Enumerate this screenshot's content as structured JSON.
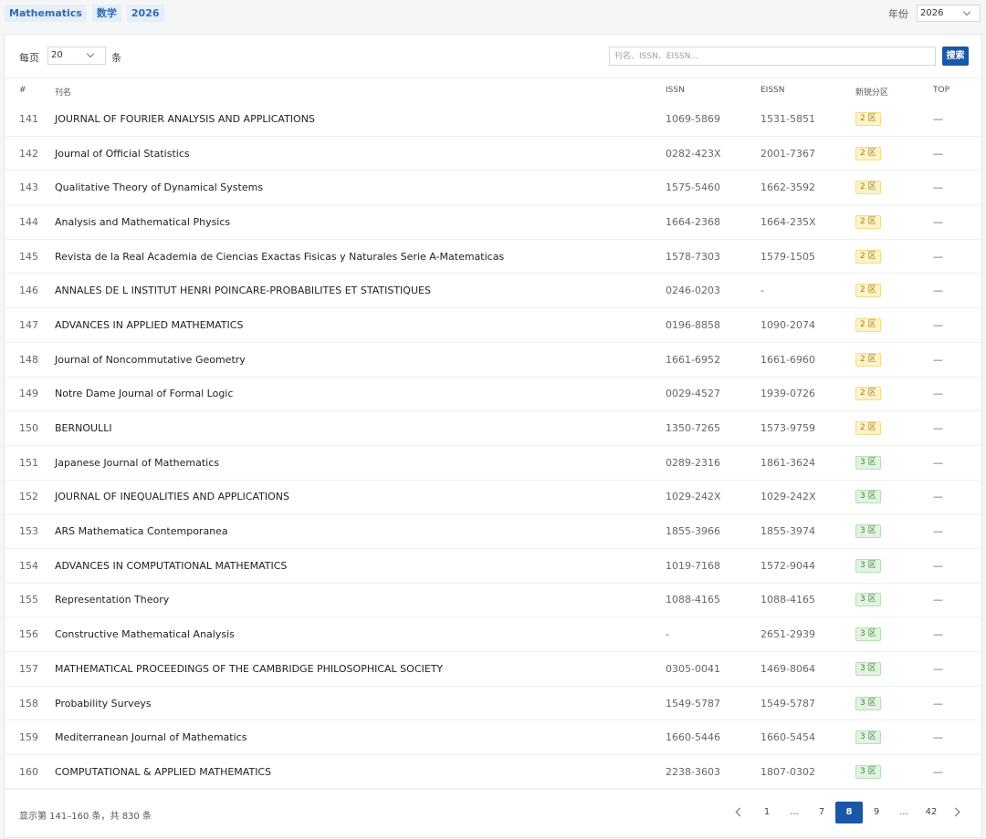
{
  "tags": [
    "Mathematics",
    "数学",
    "2026"
  ],
  "year_filter": {
    "label": "年份",
    "value": "2026"
  },
  "controls": {
    "per_page_label": "每页",
    "per_page_value": "20",
    "per_page_unit": "条",
    "search_placeholder": "刊名、ISSN、EISSN...",
    "search_button": "搜索"
  },
  "table": {
    "headers": [
      "#",
      "刊名",
      "ISSN",
      "EISSN",
      "新锐分区",
      "TOP"
    ],
    "rows": [
      {
        "num": "141",
        "name": "JOURNAL OF FOURIER ANALYSIS AND APPLICATIONS",
        "issn": "1069-5869",
        "eissn": "1531-5851",
        "zone": "2 区",
        "top": "—"
      },
      {
        "num": "142",
        "name": "Journal of Official Statistics",
        "issn": "0282-423X",
        "eissn": "2001-7367",
        "zone": "2 区",
        "top": "—"
      },
      {
        "num": "143",
        "name": "Qualitative Theory of Dynamical Systems",
        "issn": "1575-5460",
        "eissn": "1662-3592",
        "zone": "2 区",
        "top": "—"
      },
      {
        "num": "144",
        "name": "Analysis and Mathematical Physics",
        "issn": "1664-2368",
        "eissn": "1664-235X",
        "zone": "2 区",
        "top": "—"
      },
      {
        "num": "145",
        "name": "Revista de la Real Academia de Ciencias Exactas Fisicas y Naturales Serie A-Matematicas",
        "issn": "1578-7303",
        "eissn": "1579-1505",
        "zone": "2 区",
        "top": "—"
      },
      {
        "num": "146",
        "name": "ANNALES DE L INSTITUT HENRI POINCARE-PROBABILITES ET STATISTIQUES",
        "issn": "0246-0203",
        "eissn": "-",
        "zone": "2 区",
        "top": "—"
      },
      {
        "num": "147",
        "name": "ADVANCES IN APPLIED MATHEMATICS",
        "issn": "0196-8858",
        "eissn": "1090-2074",
        "zone": "2 区",
        "top": "—"
      },
      {
        "num": "148",
        "name": "Journal of Noncommutative Geometry",
        "issn": "1661-6952",
        "eissn": "1661-6960",
        "zone": "2 区",
        "top": "—"
      },
      {
        "num": "149",
        "name": "Notre Dame Journal of Formal Logic",
        "issn": "0029-4527",
        "eissn": "1939-0726",
        "zone": "2 区",
        "top": "—"
      },
      {
        "num": "150",
        "name": "BERNOULLI",
        "issn": "1350-7265",
        "eissn": "1573-9759",
        "zone": "2 区",
        "top": "—"
      },
      {
        "num": "151",
        "name": "Japanese Journal of Mathematics",
        "issn": "0289-2316",
        "eissn": "1861-3624",
        "zone": "3 区",
        "top": "—"
      },
      {
        "num": "152",
        "name": "JOURNAL OF INEQUALITIES AND APPLICATIONS",
        "issn": "1029-242X",
        "eissn": "1029-242X",
        "zone": "3 区",
        "top": "—"
      },
      {
        "num": "153",
        "name": "ARS Mathematica Contemporanea",
        "issn": "1855-3966",
        "eissn": "1855-3974",
        "zone": "3 区",
        "top": "—"
      },
      {
        "num": "154",
        "name": "ADVANCES IN COMPUTATIONAL MATHEMATICS",
        "issn": "1019-7168",
        "eissn": "1572-9044",
        "zone": "3 区",
        "top": "—"
      },
      {
        "num": "155",
        "name": "Representation Theory",
        "issn": "1088-4165",
        "eissn": "1088-4165",
        "zone": "3 区",
        "top": "—"
      },
      {
        "num": "156",
        "name": "Constructive Mathematical Analysis",
        "issn": "-",
        "eissn": "2651-2939",
        "zone": "3 区",
        "top": "—"
      },
      {
        "num": "157",
        "name": "MATHEMATICAL PROCEEDINGS OF THE CAMBRIDGE PHILOSOPHICAL SOCIETY",
        "issn": "0305-0041",
        "eissn": "1469-8064",
        "zone": "3 区",
        "top": "—"
      },
      {
        "num": "158",
        "name": "Probability Surveys",
        "issn": "1549-5787",
        "eissn": "1549-5787",
        "zone": "3 区",
        "top": "—"
      },
      {
        "num": "159",
        "name": "Mediterranean Journal of Mathematics",
        "issn": "1660-5446",
        "eissn": "1660-5454",
        "zone": "3 区",
        "top": "—"
      },
      {
        "num": "160",
        "name": "COMPUTATIONAL & APPLIED MATHEMATICS",
        "issn": "2238-3603",
        "eissn": "1807-0302",
        "zone": "3 区",
        "top": "—"
      }
    ]
  },
  "footer": {
    "summary": "显示第 141–160 条，共 830 条",
    "pages": [
      "1",
      "...",
      "7",
      "8",
      "9",
      "...",
      "42"
    ],
    "current_page": "8"
  },
  "colors": {
    "accent": "#1a57a8",
    "zone2_bg": "#fdf3c8",
    "zone3_bg": "#e2f3e1"
  }
}
